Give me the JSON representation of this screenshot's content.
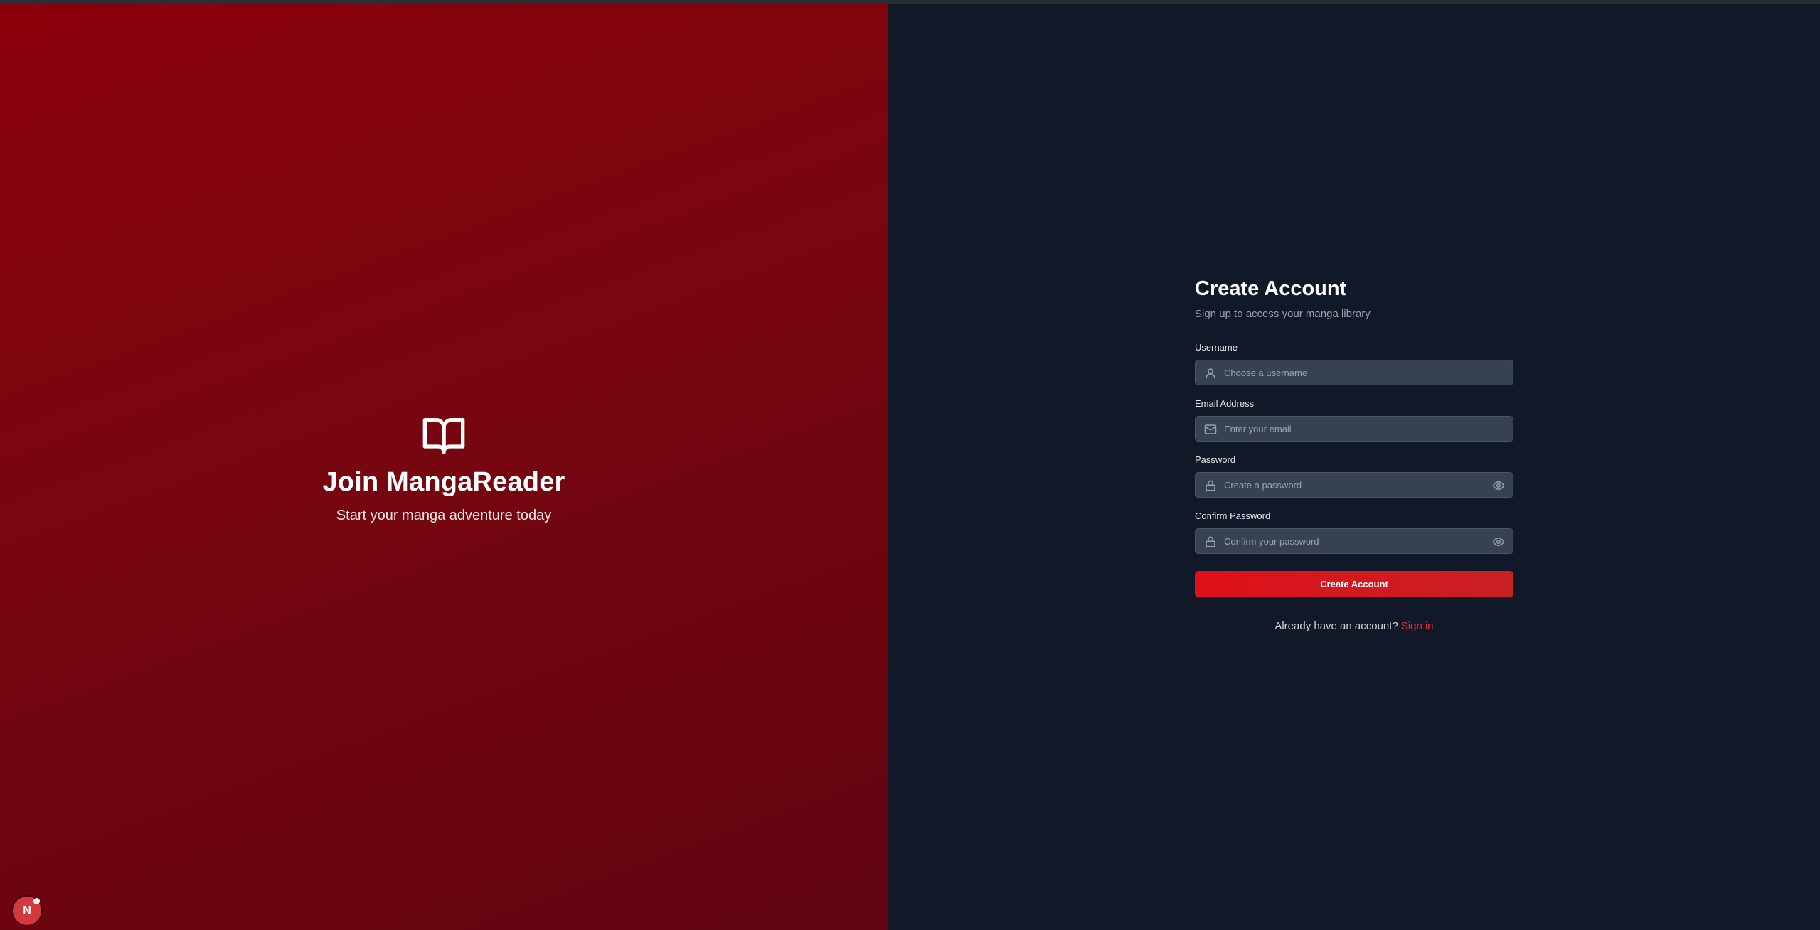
{
  "hero": {
    "icon": "open-book-icon",
    "title": "Join MangaReader",
    "subtitle": "Start your manga adventure today"
  },
  "form": {
    "title": "Create Account",
    "subtitle": "Sign up to access your manga library",
    "fields": [
      {
        "label": "Username",
        "placeholder": "Choose a username",
        "icon": "user-icon",
        "value": ""
      },
      {
        "label": "Email Address",
        "placeholder": "Enter your email",
        "icon": "mail-icon",
        "value": ""
      },
      {
        "label": "Password",
        "placeholder": "Create a password",
        "icon": "lock-icon",
        "toggle_icon": "eye-icon",
        "value": ""
      },
      {
        "label": "Confirm Password",
        "placeholder": "Confirm your password",
        "icon": "lock-icon",
        "toggle_icon": "eye-icon",
        "value": ""
      }
    ],
    "submit_label": "Create Account",
    "signin_prompt": "Already have an account?",
    "signin_link": "Sign in"
  },
  "dev_badge": {
    "letter": "N",
    "icon": "nextjs-icon"
  },
  "colors": {
    "brand_red": "#df1019",
    "panel_red": "#8a000b",
    "background_dark": "#111827",
    "input_bg": "#374151",
    "link_red": "#ef2b3a"
  }
}
